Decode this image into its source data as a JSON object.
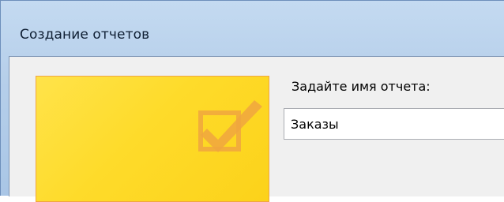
{
  "window": {
    "title": "Создание отчетов"
  },
  "form": {
    "prompt_label": "Задайте имя отчета:",
    "report_name_value": "Заказы"
  },
  "banner": {
    "icon": "checkbox-checked-icon",
    "colors": {
      "background": "#fedb2a",
      "border": "#f0a640",
      "icon": "#f0a640"
    }
  }
}
